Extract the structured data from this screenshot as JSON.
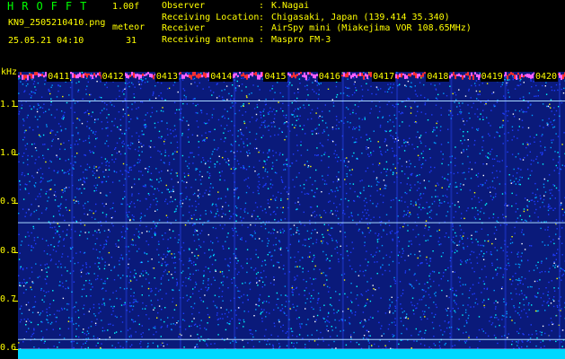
{
  "header": {
    "app_title": "HROFFT",
    "version": "1.00f",
    "filename": "KN9_2505210410.png",
    "metric_label": "meteor",
    "datetime": "25.05.21 04:10",
    "metric_value": "31",
    "info": [
      {
        "key": "Observer",
        "value": "K.Nagai"
      },
      {
        "key": "Receiving Location",
        "value": "Chigasaki, Japan (139.414 35.340)"
      },
      {
        "key": "Receiver",
        "value": "AirSpy mini (Miakejima VOR 108.65MHz)"
      },
      {
        "key": "Receiving antenna",
        "value": "Maspro FM-3"
      }
    ],
    "separator": ":"
  },
  "chart_data": {
    "type": "heatmap",
    "ylabel": "kHz",
    "y_ticks": [
      "1.1",
      "1.0",
      "0.9",
      "0.8",
      "0.7",
      "0.6"
    ],
    "y_tick_values": [
      1.1,
      1.0,
      0.9,
      0.8,
      0.7,
      0.6
    ],
    "ylim": [
      0.58,
      1.17
    ],
    "x_tick_labels": [
      "0411",
      "0412",
      "0413",
      "0414",
      "0415",
      "0416",
      "0417",
      "0418",
      "0419",
      "0420"
    ],
    "x_tick_minutes": [
      1,
      2,
      3,
      4,
      5,
      6,
      7,
      8,
      9,
      10
    ],
    "xlim_minutes": [
      0,
      10.1
    ],
    "horizontal_lines_khz": [
      1.11,
      0.86,
      0.62,
      0.6
    ],
    "background_color": "#0a1a7a",
    "noise_colors": [
      "#1e3cff",
      "#00a0ff",
      "#00ffff",
      "#ffffff",
      "#ffff00"
    ],
    "bottom_band_color": "#00d8ff",
    "top_band_color": "#ff60ff"
  }
}
